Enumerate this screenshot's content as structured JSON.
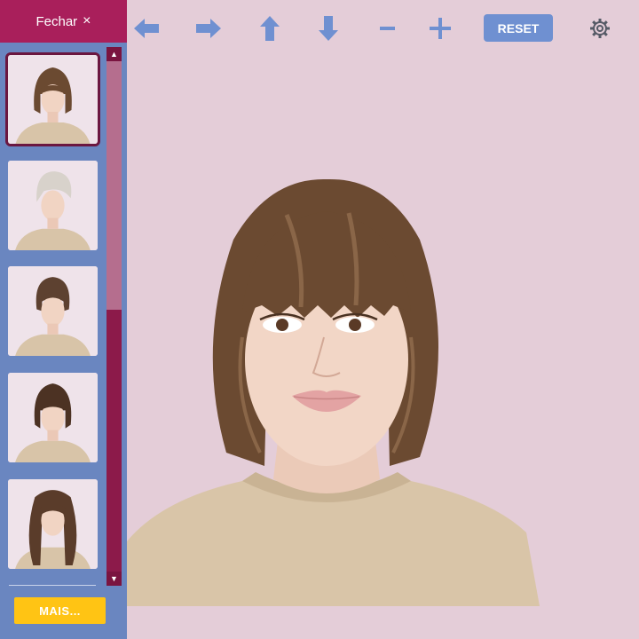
{
  "sidebar": {
    "close_label": "Fechar",
    "close_icon": "×",
    "more_label": "MAIS...",
    "thumbnails": [
      {
        "hair": "#6b4a31",
        "style": "bob"
      },
      {
        "hair": "#d8d2cb",
        "style": "short"
      },
      {
        "hair": "#5d4130",
        "style": "bob"
      },
      {
        "hair": "#4c3223",
        "style": "bob"
      },
      {
        "hair": "#5a3c2a",
        "style": "long"
      }
    ]
  },
  "toolbar": {
    "reset_label": "RESET"
  },
  "colors": {
    "background": "#e4cdd8",
    "sidebar": "#6a86c0",
    "accent": "#a91f5b",
    "more_button": "#ffc414",
    "tool_icons": "#6f90d1"
  }
}
